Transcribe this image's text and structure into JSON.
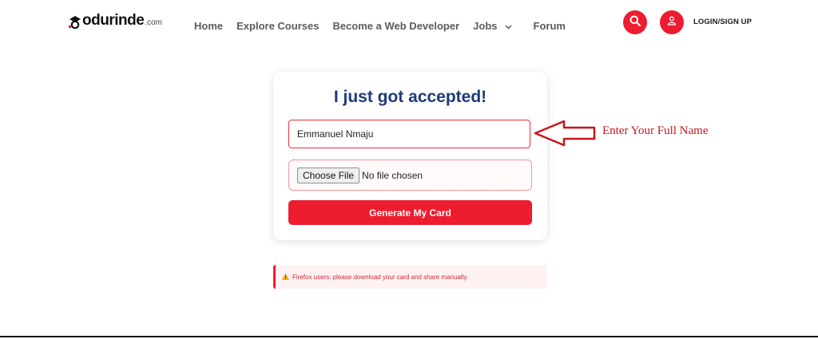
{
  "header": {
    "logo_text": "odurinde",
    "logo_domain": ".com",
    "nav": [
      "Home",
      "Explore Courses",
      "Become a Web Developer",
      "Jobs",
      "Forum"
    ],
    "login_label": "LOGIN/SIGN UP"
  },
  "card": {
    "title": "I just got accepted!",
    "name_value": "Emmanuel Nmaju",
    "file_button": "Choose File",
    "file_status": "No file chosen",
    "generate_label": "Generate My Card"
  },
  "annotation": {
    "text": "Enter Your Full Name"
  },
  "notice": {
    "message": "Firefox users: please download your card and share manually."
  },
  "colors": {
    "accent": "#ed1c2e",
    "title": "#1d3a7a",
    "annotation": "#c8161d"
  }
}
